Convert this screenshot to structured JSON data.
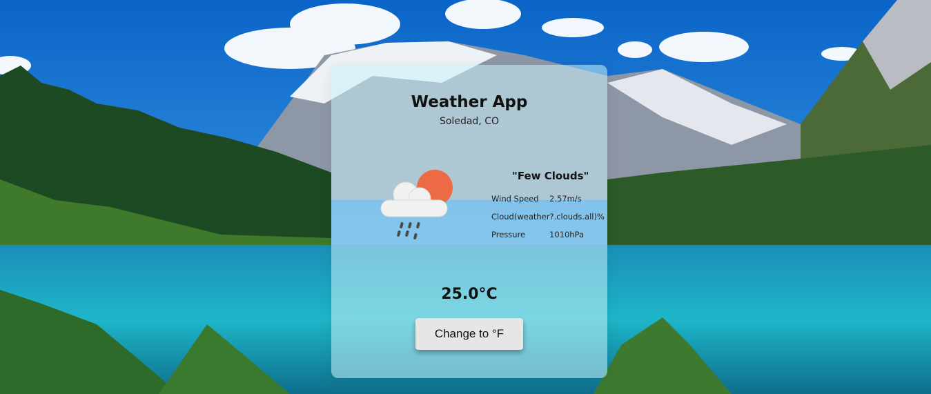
{
  "app": {
    "title": "Weather App",
    "location": "Soledad, CO"
  },
  "weather": {
    "description": "\"Few Clouds\"",
    "icon": "cloud-sun-rain-icon",
    "details": [
      {
        "label": "Wind Speed",
        "value": "2.57m/s"
      },
      {
        "label": "Cloud",
        "value": "(weather?.clouds.all)%"
      },
      {
        "label": "Pressure",
        "value": "1010hPa"
      }
    ],
    "temperature": "25.0°C"
  },
  "actions": {
    "toggle_unit_label": "Change to °F"
  },
  "colors": {
    "sun": "#ec6b45",
    "cloud": "#f1f1f1",
    "rain": "#4a4a4a",
    "card": "#c8f0f8",
    "button": "#e6e6e6"
  }
}
